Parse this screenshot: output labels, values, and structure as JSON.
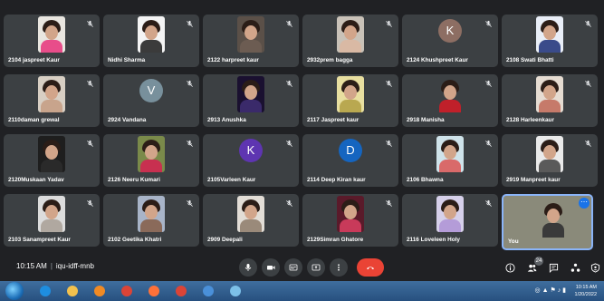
{
  "participants": [
    {
      "name": "2104 jaspreet Kaur",
      "type": "photo",
      "bg": "#e9e6e0",
      "outfit": "#e84d8a"
    },
    {
      "name": "Nidhi Sharma",
      "type": "photo",
      "bg": "#f4f4f4",
      "outfit": "#3b3b3b"
    },
    {
      "name": "2122 harpreet kaur",
      "type": "photo",
      "bg": "#5b5048",
      "outfit": "#6c5c52"
    },
    {
      "name": "2932prem bagga",
      "type": "photo",
      "bg": "#c9c2b8",
      "outfit": "#d9b9a4"
    },
    {
      "name": "2124 Khushpreet Kaur",
      "type": "avatar",
      "letter": "K",
      "color": "#8d6e63"
    },
    {
      "name": "2108 Swati Bhatti",
      "type": "photo",
      "bg": "#e9eef7",
      "outfit": "#3a4b8a"
    },
    {
      "name": "2110daman grewal",
      "type": "photo",
      "bg": "#d8cfc4",
      "outfit": "#c8a48c"
    },
    {
      "name": "2924 Vandana",
      "type": "avatar",
      "letter": "V",
      "color": "#78909c"
    },
    {
      "name": "2913 Anushka",
      "type": "photo",
      "bg": "#1a1030",
      "outfit": "#3a2a6a"
    },
    {
      "name": "2117 Jaspreet kaur",
      "type": "photo",
      "bg": "#e8dfa0",
      "outfit": "#b9a850"
    },
    {
      "name": "2918 Manisha",
      "type": "photo",
      "bg": "#3c4043",
      "outfit": "#c0202a"
    },
    {
      "name": "2128 Harleenkaur",
      "type": "photo",
      "bg": "#e6dcd2",
      "outfit": "#c67a6a"
    },
    {
      "name": "2120Muskaan Yadav",
      "type": "photo",
      "bg": "#1e1e1e",
      "outfit": "#2a2a2a"
    },
    {
      "name": "2126 Neeru Kumari",
      "type": "photo",
      "bg": "#7a8a4a",
      "outfit": "#c83050"
    },
    {
      "name": "2105Varleen Kaur",
      "type": "avatar",
      "letter": "K",
      "color": "#5e35b1"
    },
    {
      "name": "2114 Deep Kiran kaur",
      "type": "avatar",
      "letter": "D",
      "color": "#1565c0"
    },
    {
      "name": "2106 Bhawna",
      "type": "photo",
      "bg": "#cfe3ea",
      "outfit": "#d96a6a"
    },
    {
      "name": "2919 Manpreet kaur",
      "type": "photo",
      "bg": "#eaeaea",
      "outfit": "#5a5a5a"
    },
    {
      "name": "2103 Sanampreet Kaur",
      "type": "photo",
      "bg": "#dcdcdc",
      "outfit": "#b0a8a0"
    },
    {
      "name": "2102 Geetika Khatri",
      "type": "photo",
      "bg": "#a8b4c8",
      "outfit": "#8a6a5a"
    },
    {
      "name": "2909 Deepali",
      "type": "photo",
      "bg": "#e2ddd6",
      "outfit": "#9a8a7a"
    },
    {
      "name": "2129Simran Ghatore",
      "type": "photo",
      "bg": "#5a1a2a",
      "outfit": "#c83a5a"
    },
    {
      "name": "2116 Loveleen Holy",
      "type": "photo",
      "bg": "#d6d0ea",
      "outfit": "#b49cd8"
    },
    {
      "name": "You",
      "type": "self",
      "bg": "#8a8a7a",
      "outfit": "#3a3a3a"
    }
  ],
  "meeting": {
    "time": "10:15 AM",
    "separator": "|",
    "code": "iqu-idff-mnb"
  },
  "controls": {
    "mic": "mic-icon",
    "camera": "camera-icon",
    "captions": "captions-icon",
    "present": "present-icon",
    "more": "more-options-icon",
    "end": "end-call-icon"
  },
  "side_controls": {
    "people_count": "24"
  },
  "taskbar": {
    "apps": [
      {
        "icon": "internet-explorer-icon",
        "color": "#1e8ee0"
      },
      {
        "icon": "file-explorer-icon",
        "color": "#f2c14e"
      },
      {
        "icon": "media-player-icon",
        "color": "#f08a24"
      },
      {
        "icon": "chrome-icon",
        "color": "#db4437"
      },
      {
        "icon": "firefox-icon",
        "color": "#ff7139"
      },
      {
        "icon": "chrome-icon-2",
        "color": "#db4437"
      },
      {
        "icon": "window-app-icon",
        "color": "#4a90d9"
      },
      {
        "icon": "paint-app-icon",
        "color": "#7cc0e8"
      }
    ],
    "clock_time": "10:15 AM",
    "clock_date": "1/20/2022"
  },
  "colors": {
    "accent": "#8ab4f8",
    "end_call": "#ea4335",
    "tile": "#3c4043"
  }
}
